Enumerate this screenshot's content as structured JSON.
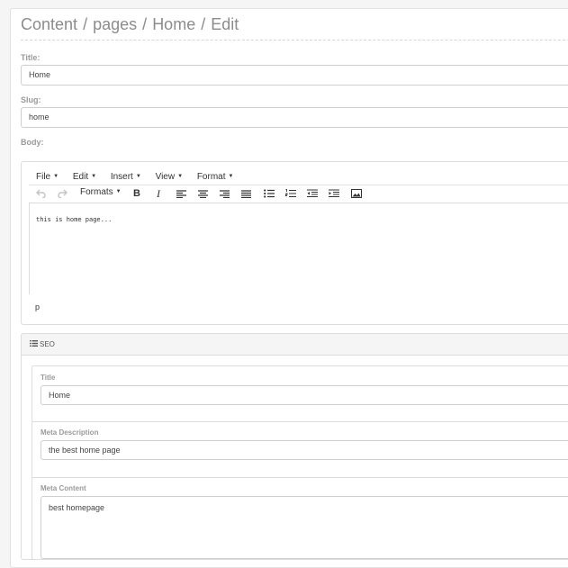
{
  "breadcrumb": {
    "items": [
      "Content",
      "pages",
      "Home",
      "Edit"
    ],
    "separator": "/"
  },
  "form": {
    "title_label": "Title:",
    "title_value": "Home",
    "slug_label": "Slug:",
    "slug_value": "home",
    "body_label": "Body:"
  },
  "editor": {
    "menus": [
      "File",
      "Edit",
      "Insert",
      "View",
      "Format"
    ],
    "formats_label": "Formats",
    "toolbar_icons": [
      "undo-icon",
      "redo-icon",
      "bold-icon",
      "italic-icon",
      "align-left-icon",
      "align-center-icon",
      "align-right-icon",
      "align-justify-icon",
      "bullet-list-icon",
      "numbered-list-icon",
      "outdent-icon",
      "indent-icon",
      "image-icon"
    ],
    "bold_glyph": "B",
    "italic_glyph": "I",
    "content": "this is home page...",
    "status_path": "p"
  },
  "seo": {
    "heading": "SEO",
    "heading_icon": "list-icon",
    "title_label": "Title",
    "title_value": "Home",
    "meta_description_label": "Meta Description",
    "meta_description_value": "the best home page",
    "meta_content_label": "Meta Content",
    "meta_content_value": "best homepage"
  }
}
